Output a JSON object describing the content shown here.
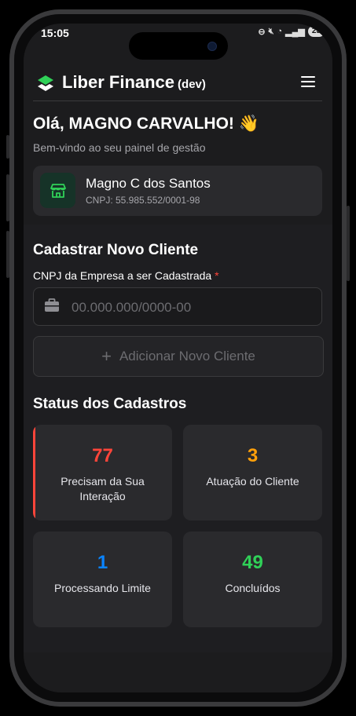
{
  "status_bar": {
    "time": "15:05",
    "battery": "23"
  },
  "header": {
    "brand": "Liber Finance",
    "env": "(dev)"
  },
  "greeting": {
    "title": "Olá, MAGNO CARVALHO! 👋",
    "subtitle": "Bem-vindo ao seu painel de gestão"
  },
  "company": {
    "name": "Magno C dos Santos",
    "cnpj": "CNPJ: 55.985.552/0001-98"
  },
  "register": {
    "title": "Cadastrar Novo Cliente",
    "field_label": "CNPJ da Empresa a ser Cadastrada",
    "required_mark": "*",
    "placeholder": "00.000.000/0000-00",
    "value": "",
    "button_label": "Adicionar Novo Cliente"
  },
  "status_section": {
    "title": "Status dos Cadastros",
    "cards": [
      {
        "count": "77",
        "label": "Precisam da Sua Interação",
        "color": "#ff453a"
      },
      {
        "count": "3",
        "label": "Atuação do Cliente",
        "color": "#ff9f0a"
      },
      {
        "count": "1",
        "label": "Processando Limite",
        "color": "#0a84ff"
      },
      {
        "count": "49",
        "label": "Concluídos",
        "color": "#30d158"
      }
    ]
  },
  "colors": {
    "background": "#1c1c1e",
    "card": "#2a2a2d",
    "accent_green": "#30d158"
  },
  "icons": [
    "logo-icon",
    "menu-icon",
    "store-icon",
    "briefcase-icon",
    "plus-icon"
  ]
}
